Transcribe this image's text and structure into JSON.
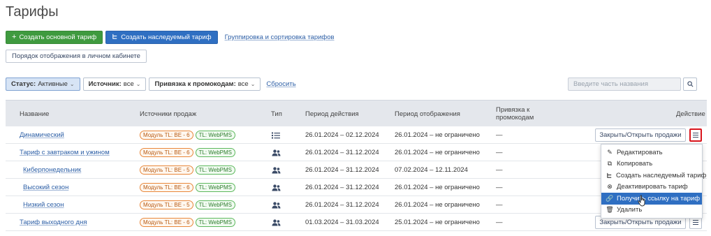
{
  "page": {
    "title": "Тарифы"
  },
  "toolbar": {
    "create_main": "Создать основной тариф",
    "create_derived": "Создать наследуемый тариф",
    "grouping_link": "Группировка и сортировка тарифов",
    "display_order": "Порядок отображения в личном кабинете"
  },
  "filters": {
    "status_label": "Статус:",
    "status_value": "Активные",
    "source_label": "Источник:",
    "source_value": "все",
    "promo_label": "Привязка к промокодам:",
    "promo_value": "все",
    "reset": "Сбросить",
    "search_placeholder": "Введите часть названия"
  },
  "table": {
    "headers": {
      "name": "Название",
      "sources": "Источники продаж",
      "type": "Тип",
      "period": "Период действия",
      "display": "Период отображения",
      "promo": "Привязка к промокодам",
      "action": "Действие"
    },
    "rows": [
      {
        "name": "Динамический",
        "tag1": "Модуль TL: BE - 6",
        "tag2": "TL: WebPMS",
        "type_icon": "list-icon",
        "period": "26.01.2024 – 02.12.2024",
        "display": "26.01.2024 – не ограничено",
        "promo": "—",
        "action": "Закрыть/Открыть продажи"
      },
      {
        "name": "Тариф с завтраком и ужином",
        "tag1": "Модуль TL: BE - 6",
        "tag2": "TL: WebPMS",
        "type_icon": "users-icon",
        "period": "26.01.2024 – 31.12.2024",
        "display": "26.01.2024 – не ограничено",
        "promo": "—",
        "action": ""
      },
      {
        "name": "Киберпонедельник",
        "tag1": "Модуль TL: BE - 5",
        "tag2": "TL: WebPMS",
        "type_icon": "users-icon",
        "period": "26.01.2024 – 31.12.2024",
        "display": "07.02.2024 – 12.11.2024",
        "promo": "—",
        "action": ""
      },
      {
        "name": "Высокий сезон",
        "tag1": "Модуль TL: BE - 6",
        "tag2": "TL: WebPMS",
        "type_icon": "users-icon",
        "period": "26.01.2024 – 31.12.2024",
        "display": "26.01.2024 – не ограничено",
        "promo": "—",
        "action": ""
      },
      {
        "name": "Низкий сезон",
        "tag1": "Модуль TL: BE - 5",
        "tag2": "TL: WebPMS",
        "type_icon": "users-icon",
        "period": "26.01.2024 – 31.12.2024",
        "display": "26.01.2024 – не ограничено",
        "promo": "—",
        "action": ""
      },
      {
        "name": "Тариф выходного дня",
        "tag1": "Модуль TL: BE - 6",
        "tag2": "TL: WebPMS",
        "type_icon": "users-icon",
        "period": "01.03.2024 – 31.03.2024",
        "display": "25.01.2024 – не ограничено",
        "promo": "—",
        "action": "Закрыть/Открыть продажи"
      }
    ]
  },
  "context_menu": {
    "items": [
      {
        "label": "Редактировать",
        "icon": "pencil-icon"
      },
      {
        "label": "Копировать",
        "icon": "copy-icon"
      },
      {
        "label": "Создать наследуемый тариф",
        "icon": "branch-icon"
      },
      {
        "label": "Деактивировать тариф",
        "icon": "deactivate-icon"
      },
      {
        "label": "Получить ссылку на тариф",
        "icon": "link-icon",
        "selected": true
      },
      {
        "label": "Удалить",
        "icon": "trash-icon"
      }
    ]
  },
  "colors": {
    "primary": "#2f6fc2",
    "success": "#3f9a3f",
    "highlight": "#d9141c"
  }
}
